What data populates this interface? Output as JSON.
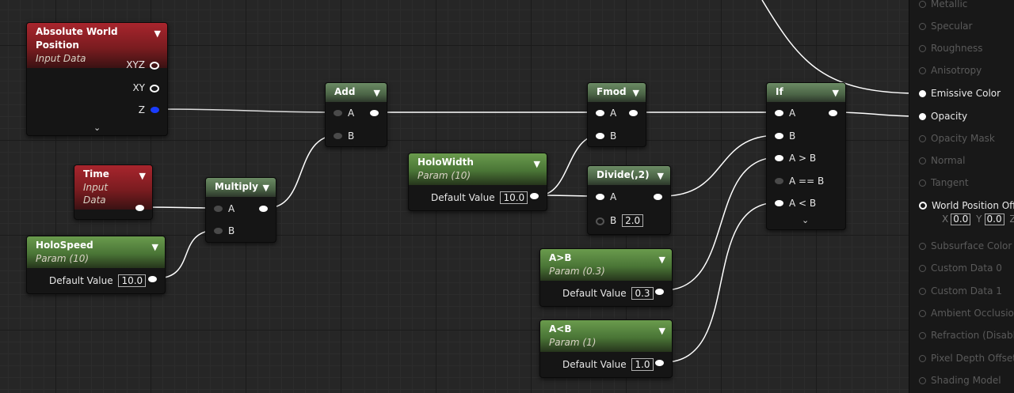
{
  "nodes": {
    "abs_world_pos": {
      "title": "Absolute World Position",
      "subtitle": "Input Data",
      "outputs": [
        "XYZ",
        "XY",
        "Z"
      ]
    },
    "time": {
      "title": "Time",
      "subtitle": "Input Data"
    },
    "holo_speed": {
      "title": "HoloSpeed",
      "subtitle": "Param (10)",
      "label": "Default Value",
      "value": "10.0"
    },
    "multiply": {
      "title": "Multiply",
      "in_a": "A",
      "in_b": "B"
    },
    "add": {
      "title": "Add",
      "in_a": "A",
      "in_b": "B"
    },
    "holo_width": {
      "title": "HoloWidth",
      "subtitle": "Param (10)",
      "label": "Default Value",
      "value": "10.0"
    },
    "fmod": {
      "title": "Fmod",
      "in_a": "A",
      "in_b": "B"
    },
    "divide": {
      "title": "Divide(,2)",
      "in_a": "A",
      "in_b": "B",
      "b_value": "2.0"
    },
    "agtb": {
      "title": "A>B",
      "subtitle": "Param (0.3)",
      "label": "Default Value",
      "value": "0.3"
    },
    "altb": {
      "title": "A<B",
      "subtitle": "Param (1)",
      "label": "Default Value",
      "value": "1.0"
    },
    "if_node": {
      "title": "If",
      "inputs": [
        "A",
        "B",
        "A > B",
        "A == B",
        "A < B"
      ]
    }
  },
  "panel": {
    "items": [
      {
        "label": "Metallic",
        "state": "off"
      },
      {
        "label": "Specular",
        "state": "off"
      },
      {
        "label": "Roughness",
        "state": "off"
      },
      {
        "label": "Anisotropy",
        "state": "off"
      },
      {
        "label": "Emissive Color",
        "state": "on"
      },
      {
        "label": "Opacity",
        "state": "on"
      },
      {
        "label": "Opacity Mask",
        "state": "off"
      },
      {
        "label": "Normal",
        "state": "off"
      },
      {
        "label": "Tangent",
        "state": "off"
      },
      {
        "label": "World Position Offset",
        "state": "ring"
      },
      {
        "label": "Subsurface Color",
        "state": "off"
      },
      {
        "label": "Custom Data 0",
        "state": "off"
      },
      {
        "label": "Custom Data 1",
        "state": "off"
      },
      {
        "label": "Ambient Occlusion",
        "state": "off"
      },
      {
        "label": "Refraction (Disabled)",
        "state": "off"
      },
      {
        "label": "Pixel Depth Offset (Disabled)",
        "state": "off"
      },
      {
        "label": "Shading Model",
        "state": "off"
      }
    ],
    "wpo": {
      "x_label": "X",
      "x_value": "0.0",
      "y_label": "Y",
      "y_value": "0.0",
      "z_label": "Z"
    }
  },
  "colors": {
    "wire": "#ffffff",
    "blue_pin": "#1a3cff",
    "red_header": "#a8252d",
    "green_header": "#4a7536"
  }
}
